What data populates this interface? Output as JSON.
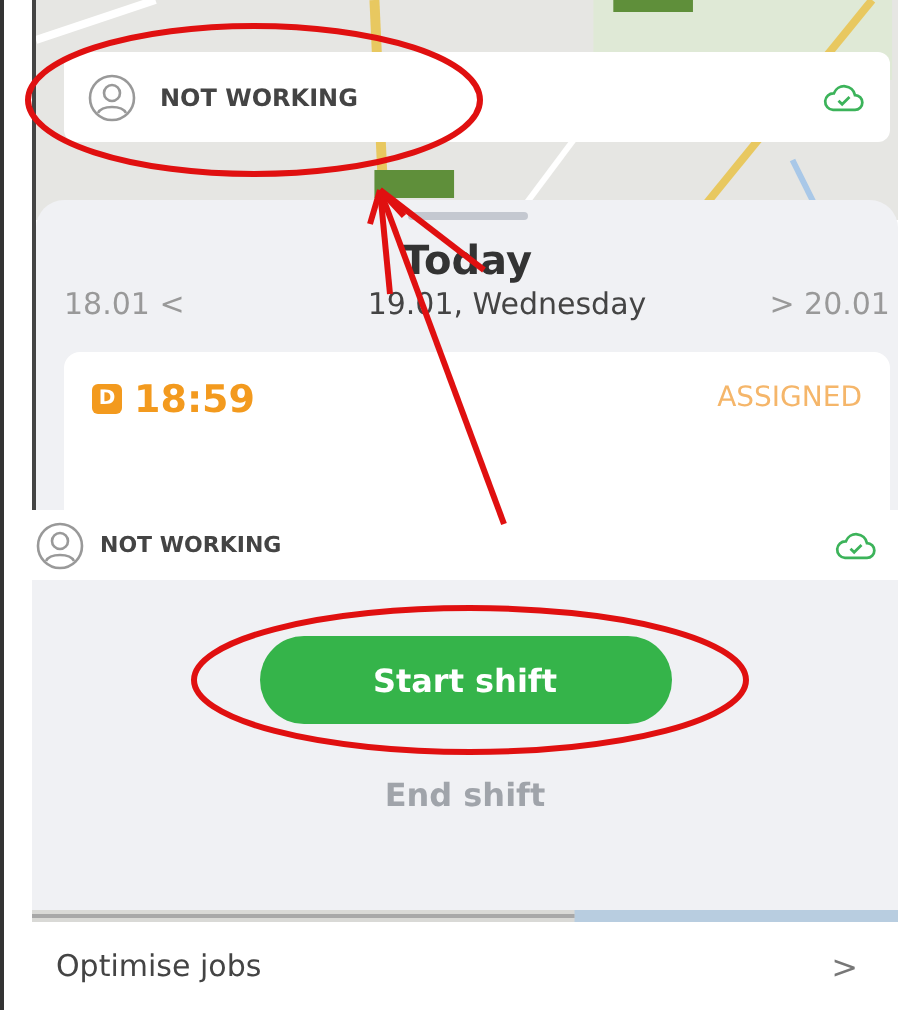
{
  "top_screen": {
    "status": {
      "label": "NOT WORKING",
      "synced": true
    },
    "sheet": {
      "title": "Today",
      "prev_date": "18.01",
      "prev_arrow": "<",
      "current_date": "19.01, Wednesday",
      "next_arrow": ">",
      "next_date": "20.01"
    },
    "job": {
      "type_badge": "D",
      "time": "18:59",
      "status": "ASSIGNED"
    }
  },
  "bottom_screen": {
    "status": {
      "label": "NOT WORKING",
      "synced": true
    },
    "buttons": [
      {
        "label": "Start shift",
        "kind": "primary",
        "disabled": false
      },
      {
        "label": "End shift",
        "kind": "text",
        "disabled": true
      }
    ],
    "menu_items": [
      {
        "label": "Optimise jobs",
        "arrow": ">"
      }
    ]
  }
}
